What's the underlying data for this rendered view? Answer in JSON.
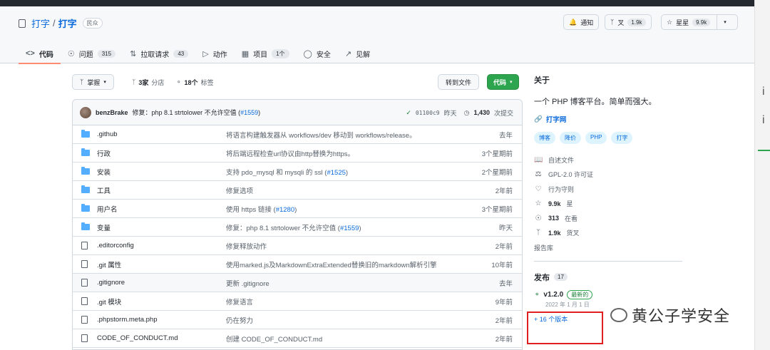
{
  "repo": {
    "owner": "打字",
    "name": "打字",
    "visibility": "民众"
  },
  "actions": {
    "notify": "通知",
    "fork": "叉",
    "fork_count": "1.9k",
    "star": "星星",
    "star_count": "9.9k"
  },
  "tabs": [
    {
      "label": "代码",
      "icon": "code-icon"
    },
    {
      "label": "问题",
      "count": "315",
      "icon": "issue-icon"
    },
    {
      "label": "拉取请求",
      "count": "43",
      "icon": "pull-request-icon"
    },
    {
      "label": "动作",
      "icon": "play-icon"
    },
    {
      "label": "项目",
      "count": "1个",
      "icon": "table-icon"
    },
    {
      "label": "安全",
      "icon": "shield-icon"
    },
    {
      "label": "见解",
      "icon": "graph-icon"
    }
  ],
  "toolbar": {
    "branch": "掌握",
    "branches_count": "3家",
    "branches_label": "分店",
    "tags_count": "18个",
    "tags_label": "标签",
    "goto_file": "转到文件",
    "code": "代码"
  },
  "commit": {
    "author": "benzBrake",
    "message": "修复：php 8.1 strtolower 不允许空值 (",
    "pr": "#1559",
    "close": ")",
    "sha": "01100c9",
    "date": "昨天",
    "count": "1,430",
    "count_label": "次提交"
  },
  "files": [
    {
      "type": "dir",
      "name": ".github",
      "msg": "将语言构建触发器从 workflows/dev 移动到 workflows/release。",
      "age": "去年"
    },
    {
      "type": "dir",
      "name": "行政",
      "msg": "将后端远程检查url协议由http替换为https。",
      "age": "3个星期前"
    },
    {
      "type": "dir",
      "name": "安装",
      "msg": "支持 pdo_mysql 和 mysqli 的 ssl (",
      "pr": "#1525",
      "close": ")",
      "age": "2个星期前"
    },
    {
      "type": "dir",
      "name": "工具",
      "msg": "修复选项",
      "age": "2年前"
    },
    {
      "type": "dir",
      "name": "用户名",
      "msg": "使用 https 链接 (",
      "pr": "#1280",
      "close": ")",
      "age": "3个星期前"
    },
    {
      "type": "dir",
      "name": "变量",
      "msg": "修复：php 8.1 strtolower 不允许空值 (",
      "pr": "#1559",
      "close": ")",
      "age": "昨天"
    },
    {
      "type": "file",
      "name": ".editorconfig",
      "msg": "修复释放动作",
      "age": "2年前"
    },
    {
      "type": "file",
      "name": ".git 属性",
      "msg": "使用marked.js及MarkdownExtraExtended替换旧的markdown解析引擎",
      "age": "10年前"
    },
    {
      "type": "file",
      "name": ".gitignore",
      "msg": "更新 .gitignore",
      "age": "去年"
    },
    {
      "type": "file",
      "name": ".git 模块",
      "msg": "修复语言",
      "age": "9年前"
    },
    {
      "type": "file",
      "name": ".phpstorm.meta.php",
      "msg": "仍在努力",
      "age": "2年前"
    },
    {
      "type": "file",
      "name": "CODE_OF_CONDUCT.md",
      "msg": "创建 CODE_OF_CONDUCT.md",
      "age": "2年前"
    }
  ],
  "about": {
    "title": "关于",
    "description": "一个 PHP 博客平台。简单而强大。",
    "website": "打字网",
    "topics": [
      "博客",
      "降价",
      "PHP",
      "打字"
    ],
    "meta": [
      {
        "icon": "book-icon",
        "label": "自述文件"
      },
      {
        "icon": "law-icon",
        "label": "GPL-2.0 许可证"
      },
      {
        "icon": "heart-icon",
        "label": "行为守则"
      },
      {
        "icon": "star-icon",
        "value": "9.9k",
        "label": "星"
      },
      {
        "icon": "eye-icon",
        "value": "313",
        "label": "在看"
      },
      {
        "icon": "fork-icon",
        "value": "1.9k",
        "label": "货叉"
      },
      {
        "icon": "",
        "label": "报告库"
      }
    ]
  },
  "releases": {
    "title": "发布",
    "count": "17",
    "latest_tag": "v1.2.0",
    "latest_label": "最新的",
    "date": "2022 年 1 月 1 日",
    "more": "+ 16 个版本"
  },
  "watermark": "黄公子学安全"
}
